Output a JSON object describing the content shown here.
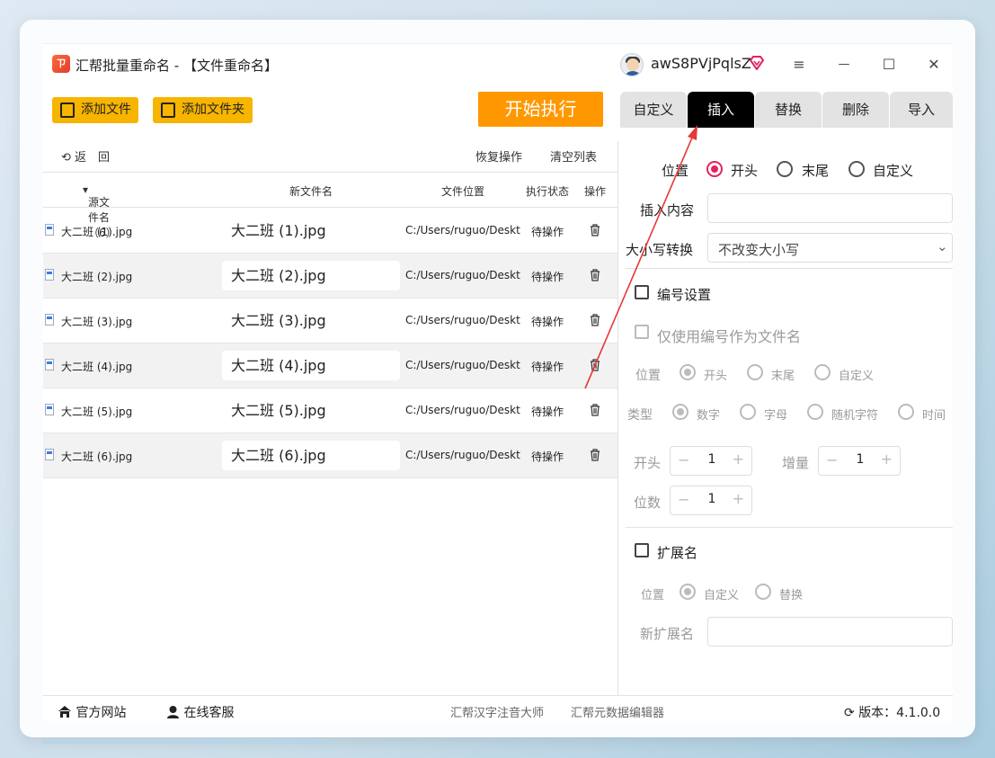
{
  "app": {
    "title": "汇帮批量重命名 - 【文件重命名】",
    "username": "awS8PVjPqlsZ"
  },
  "window_controls": {
    "menu": "≡",
    "minimize": "—",
    "maximize": "☐",
    "close": "✕"
  },
  "toolbar": {
    "add_file": "添加文件",
    "add_folder": "添加文件夹",
    "start": "开始执行"
  },
  "tabs": [
    {
      "label": "自定义",
      "active": false
    },
    {
      "label": "插入",
      "active": true
    },
    {
      "label": "替换",
      "active": false
    },
    {
      "label": "删除",
      "active": false
    },
    {
      "label": "导入",
      "active": false
    }
  ],
  "list_toolbar": {
    "back": "返　回",
    "restore": "恢复操作",
    "clear": "清空列表"
  },
  "list_header": {
    "source": "源文件名（6）",
    "new": "新文件名",
    "location": "文件位置",
    "status": "执行状态",
    "action": "操作"
  },
  "rows": [
    {
      "orig": "大二班 (1).jpg",
      "new": "大二班 (1).jpg",
      "path": "C:/Users/ruguo/Desktop",
      "status": "待操作"
    },
    {
      "orig": "大二班 (2).jpg",
      "new": "大二班 (2).jpg",
      "path": "C:/Users/ruguo/Desktop",
      "status": "待操作"
    },
    {
      "orig": "大二班 (3).jpg",
      "new": "大二班 (3).jpg",
      "path": "C:/Users/ruguo/Desktop",
      "status": "待操作"
    },
    {
      "orig": "大二班 (4).jpg",
      "new": "大二班 (4).jpg",
      "path": "C:/Users/ruguo/Desktop",
      "status": "待操作"
    },
    {
      "orig": "大二班 (5).jpg",
      "new": "大二班 (5).jpg",
      "path": "C:/Users/ruguo/Desktop",
      "status": "待操作"
    },
    {
      "orig": "大二班 (6).jpg",
      "new": "大二班 (6).jpg",
      "path": "C:/Users/ruguo/Desktop",
      "status": "待操作"
    }
  ],
  "insert_panel": {
    "position_label": "位置",
    "position_options": [
      "开头",
      "末尾",
      "自定义"
    ],
    "position_selected": "开头",
    "content_label": "插入内容",
    "content_value": "",
    "case_label": "大小写转换",
    "case_value": "不改变大小写"
  },
  "numbering": {
    "label": "编号设置",
    "only_number_label": "仅使用编号作为文件名",
    "position_label": "位置",
    "position_options": [
      "开头",
      "末尾",
      "自定义"
    ],
    "type_label": "类型",
    "type_options": [
      "数字",
      "字母",
      "随机字符",
      "时间"
    ],
    "start_label": "开头",
    "start_value": "1",
    "step_label": "增量",
    "step_value": "1",
    "digits_label": "位数",
    "digits_value": "1"
  },
  "extension": {
    "label": "扩展名",
    "position_label": "位置",
    "options": [
      "自定义",
      "替换"
    ],
    "new_ext_label": "新扩展名"
  },
  "footer": {
    "website": "官方网站",
    "support": "在线客服",
    "link1": "汇帮汉字注音大师",
    "link2": "汇帮元数据编辑器",
    "version": "版本：4.1.0.0"
  },
  "colors": {
    "accent": "#f7b500",
    "start": "#ff9800",
    "radio": "#e0245e",
    "arrow": "#e53935"
  }
}
